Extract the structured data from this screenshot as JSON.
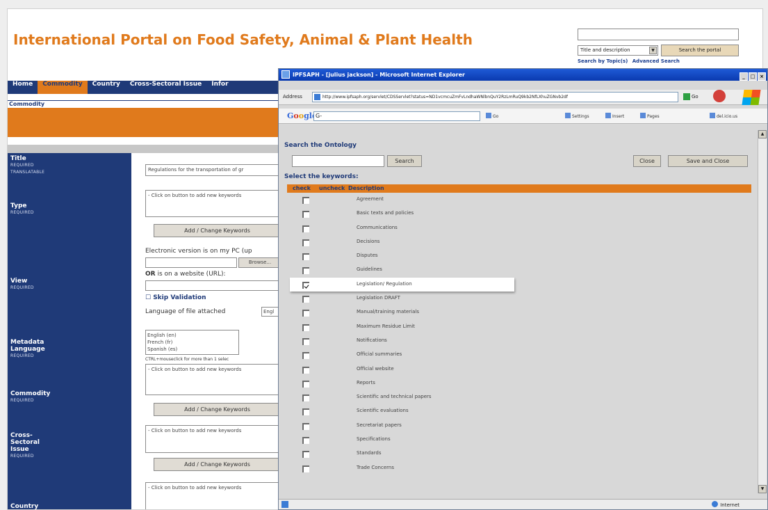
{
  "portal": {
    "title": "International Portal on Food Safety, Animal & Plant Health",
    "search": {
      "select_value": "Title and description",
      "button": "Search the portal",
      "link_topics": "Search by Topic(s)",
      "link_advanced": "Advanced Search"
    },
    "nav": [
      "Home",
      "Commodity",
      "Country",
      "Cross-Sectoral Issue",
      "Infor"
    ],
    "breadcrumb": "Commodity",
    "form": {
      "title_label": "Title",
      "title_sub": "REQUIRED",
      "title_sub2": "TRANSLATABLE",
      "title_value": "Regulations for the transportation of gr",
      "type_label": "Type",
      "type_sub": "REQUIRED",
      "keyword_placeholder": "- Click on button to add new keywords",
      "add_change": "Add / Change Keywords",
      "electronic_text": "Electronic version is on my PC (up",
      "browse": "Browse...",
      "or_website_bold": "OR",
      "or_website_rest": " is on a website (URL):",
      "view_label": "View",
      "view_sub": "REQUIRED",
      "skip_validation": "Skip Validation",
      "language_attached": "Language of file attached",
      "language_attached_value": "Engl",
      "metadata_label": "Metadata",
      "metadata_label2": "Language",
      "metadata_sub": "REQUIRED",
      "languages": [
        "English (en)",
        "French (fr)",
        "Spanish (es)"
      ],
      "ctrl_hint": "CTRL+mouseclick for more than 1 selec",
      "commodity_label": "Commodity",
      "commodity_sub": "REQUIRED",
      "cross_label1": "Cross-",
      "cross_label2": "Sectoral",
      "cross_label3": "Issue",
      "cross_sub": "REQUIRED",
      "country_label": "Country"
    }
  },
  "ie": {
    "title": "IPFSAPH - [julius jackson] - Microsoft Internet Explorer",
    "address_label": "Address",
    "address_url": "http://www.ipfsaph.org/servlet/CDSServlet?status=ND1vcmcuZmFvLndhaWNlbnQuY2RzLmRuQ9kb2NfLXhuZGNvb2df",
    "go": "Go",
    "google_input": "G-",
    "toolbar": [
      "Go",
      "Settings",
      "Insert",
      "Pages",
      "del.icio.us"
    ],
    "status_zone": "Internet"
  },
  "ontology": {
    "title": "Search the Ontology",
    "search_button": "Search",
    "close_button": "Close",
    "save_close_button": "Save and Close",
    "keywords_title": "Select the keywords:",
    "columns": [
      "check",
      "uncheck",
      "Description"
    ],
    "keywords": [
      {
        "label": "Agreement",
        "checked": false
      },
      {
        "label": "Basic texts and policies",
        "checked": false
      },
      {
        "label": "Communications",
        "checked": false
      },
      {
        "label": "Decisions",
        "checked": false
      },
      {
        "label": "Disputes",
        "checked": false
      },
      {
        "label": "Guidelines",
        "checked": false
      },
      {
        "label": "Legislation/ Regulation",
        "checked": true
      },
      {
        "label": "Legislation DRAFT",
        "checked": false
      },
      {
        "label": "Manual/training materials",
        "checked": false
      },
      {
        "label": "Maximum Residue Limit",
        "checked": false
      },
      {
        "label": "Notifications",
        "checked": false
      },
      {
        "label": "Official summaries",
        "checked": false
      },
      {
        "label": "Official website",
        "checked": false
      },
      {
        "label": "Reports",
        "checked": false
      },
      {
        "label": "Scientific and technical papers",
        "checked": false
      },
      {
        "label": "Scientific evaluations",
        "checked": false
      },
      {
        "label": "Secretariat papers",
        "checked": false
      },
      {
        "label": "Specifications",
        "checked": false
      },
      {
        "label": "Standards",
        "checked": false
      },
      {
        "label": "Trade Concerns",
        "checked": false
      }
    ]
  },
  "colors": {
    "brand_orange": "#e07a1c",
    "brand_navy": "#1f3a78"
  }
}
